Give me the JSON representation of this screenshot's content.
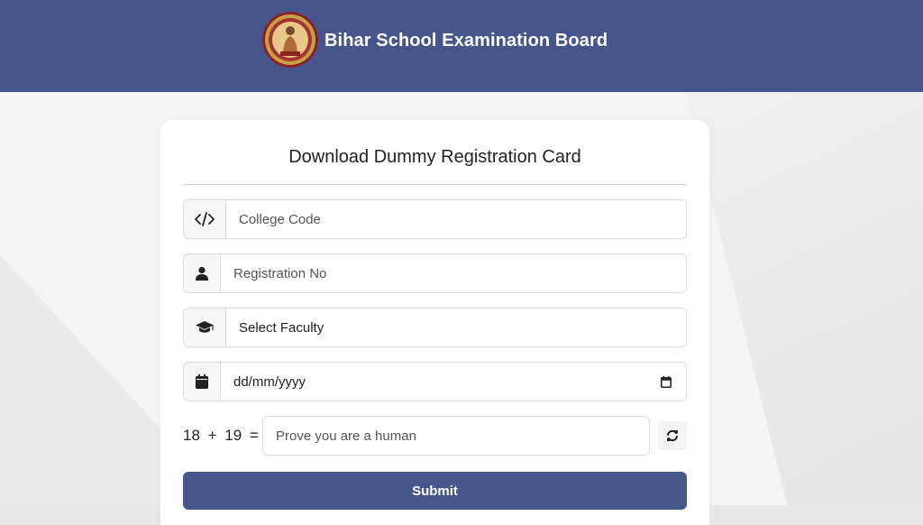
{
  "header": {
    "title": "Bihar School Examination Board",
    "background_color": "#46558c",
    "logo_icon": "bseb-seal-icon"
  },
  "form": {
    "title": "Download Dummy Registration Card",
    "fields": {
      "college_code": {
        "placeholder": "College Code",
        "icon": "code-icon"
      },
      "registration_no": {
        "placeholder": "Registration No",
        "icon": "user-icon"
      },
      "faculty": {
        "value": "Select Faculty",
        "icon": "graduation-cap-icon"
      },
      "date": {
        "placeholder": "dd/mm/yyyy",
        "icon": "calendar-icon",
        "picker_icon": "calendar-picker-icon"
      }
    },
    "captcha": {
      "expression": "18 + 19 =",
      "placeholder": "Prove you are a human",
      "refresh_icon": "refresh-icon"
    },
    "submit_label": "Submit",
    "accent_color": "#46558c"
  }
}
